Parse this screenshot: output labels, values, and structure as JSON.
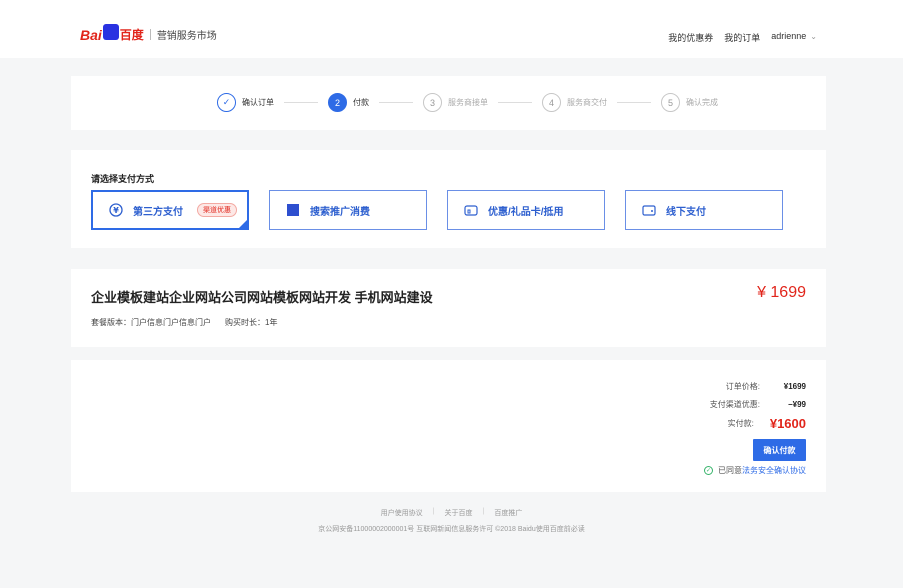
{
  "header": {
    "logo_bai": "Bai",
    "logo_cn": "百度",
    "subtitle": "营销服务市场",
    "nav": [
      "我的优惠券",
      "我的订单"
    ],
    "user": "adrienne"
  },
  "steps": [
    {
      "num": "✓",
      "label": "确认订单",
      "state": "done"
    },
    {
      "num": "2",
      "label": "付款",
      "state": "active"
    },
    {
      "num": "3",
      "label": "服务商接单",
      "state": "todo"
    },
    {
      "num": "4",
      "label": "服务商交付",
      "state": "todo"
    },
    {
      "num": "5",
      "label": "确认完成",
      "state": "todo"
    }
  ],
  "payment": {
    "title": "请选择支付方式",
    "options": [
      {
        "label": "第三方支付",
        "badge": "渠道优惠",
        "icon": "yen-circle-icon"
      },
      {
        "label": "搜索推广消费",
        "icon": "square-icon"
      },
      {
        "label": "优惠/礼品卡/抵用",
        "icon": "gift-card-icon"
      },
      {
        "label": "线下支付",
        "icon": "wallet-icon"
      }
    ]
  },
  "product": {
    "name": "企业模板建站企业网站公司网站模板网站开发 手机网站建设",
    "price": "¥ 1699",
    "package_label": "套餐版本：",
    "package_value": "门户信息门户信息门户",
    "duration_label": "购买时长：",
    "duration_value": "1年"
  },
  "summary": {
    "order_price_label": "订单价格:",
    "order_price": "¥1699",
    "discount_label": "支付渠道优惠:",
    "discount": "−¥99",
    "paid_label": "实付款:",
    "paid": "¥1600",
    "confirm_button": "确认付款",
    "agree_text": "已同意",
    "agree_link": "法务安全确认协议"
  },
  "footer": {
    "links": [
      "用户使用协议",
      "关于百度",
      "百度推广"
    ],
    "copyright": "京公网安备11000002000001号 互联网新闻信息服务许可 ©2018 Baidu使用百度前必读"
  },
  "colors": {
    "accent": "#2e6be6",
    "price": "#e1251b",
    "background": "#f5f6f7"
  }
}
